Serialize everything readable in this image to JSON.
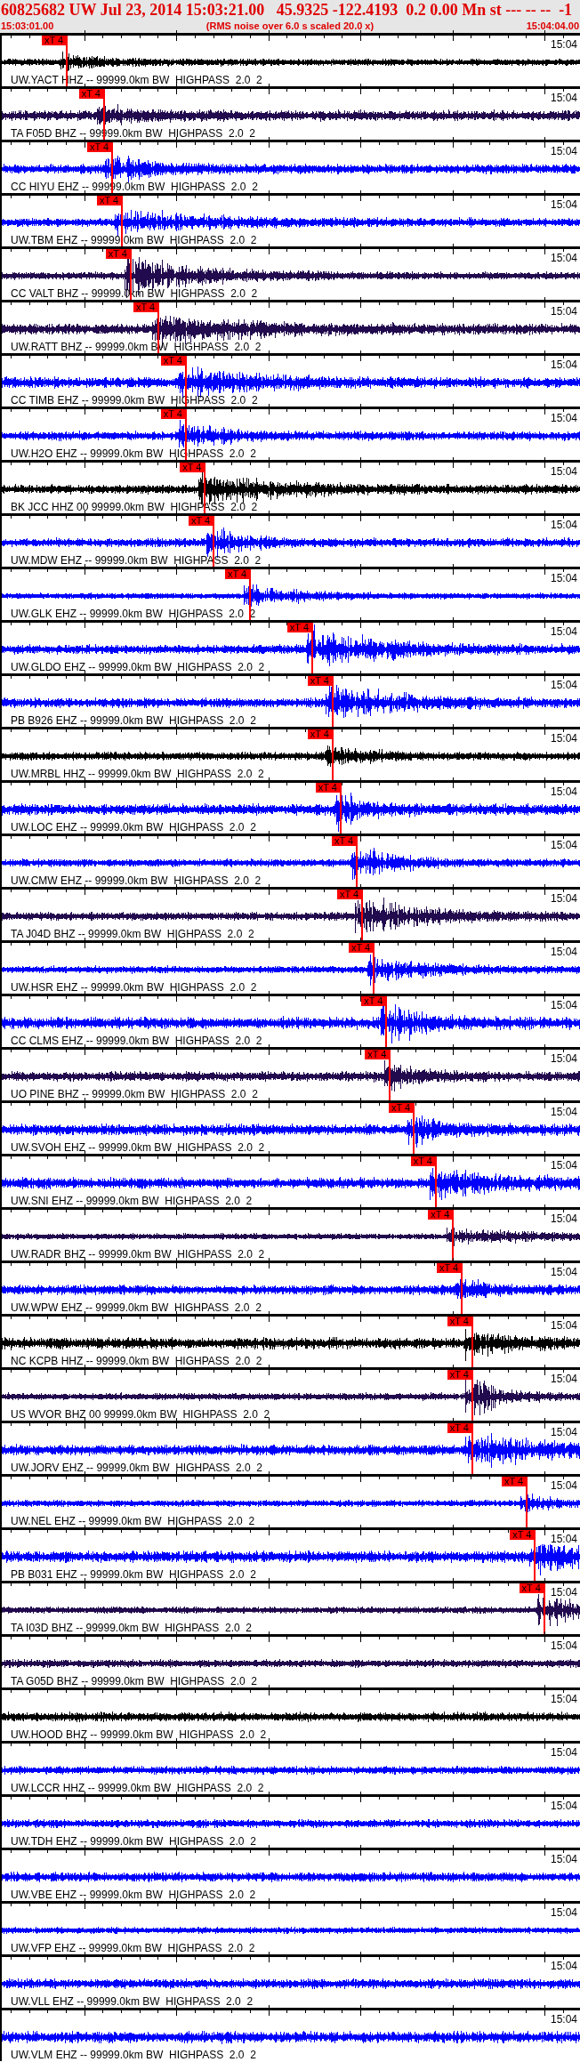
{
  "header": {
    "title": "60825682 UW Jul 23, 2014 15:03:21.00   45.9325 -122.4193  0.2 0.00 Mn st --- -- --  -1",
    "start_time": "15:03:01.00",
    "subtitle": "(RMS noise over 6.0 s scaled 20.0 x)",
    "end_time": "15:04:04.00"
  },
  "traces": [
    {
      "label": "UW.YACT HHZ -- 99999.0km BW  HIGHPASS  2.0  2",
      "color": "#000000",
      "time_label": "15:04",
      "pick": {
        "label": "xT 4",
        "level": 0.112
      }
    },
    {
      "label": "TA F05D BHZ -- 99999.0km BW  HIGHPASS  2.0  2",
      "color": "#220a4e",
      "time_label": "15:04",
      "pick": {
        "label": "xT 4",
        "level": 0.176
      }
    },
    {
      "label": "CC HIYU EHZ -- 99999.0km BW  HIGHPASS  2.0  2",
      "color": "#0000ff",
      "time_label": "15:04",
      "pick": {
        "label": "xT 4",
        "level": 0.19
      }
    },
    {
      "label": "UW.TBM EHZ -- 99999.0km BW  HIGHPASS  2.0  2",
      "color": "#0000ff",
      "time_label": "15:04",
      "pick": {
        "label": "xT 4",
        "level": 0.207
      }
    },
    {
      "label": "CC VALT BHZ -- 99999.0km BW  HIGHPASS  2.0  2",
      "color": "#220a4e",
      "time_label": "15:04",
      "pick": {
        "label": "xT 4",
        "level": 0.222
      }
    },
    {
      "label": "UW.RATT BHZ -- 99999.0km BW  HIGHPASS  2.0  2",
      "color": "#220a4e",
      "time_label": "15:04",
      "pick": {
        "label": "xT 4",
        "level": 0.27
      }
    },
    {
      "label": "CC TIMB EHZ -- 99999.0km BW  HIGHPASS  2.0  2",
      "color": "#0000ff",
      "time_label": "15:04",
      "pick": {
        "label": "xT 4",
        "level": 0.317
      }
    },
    {
      "label": "UW.H2O EHZ -- 99999.0km BW  HIGHPASS  2.0  2",
      "color": "#0000ff",
      "time_label": "15:04",
      "pick": {
        "label": "xT 4",
        "level": 0.317
      }
    },
    {
      "label": "BK JCC HHZ 00 99999.0km BW  HIGHPASS  2.0  2",
      "color": "#000000",
      "time_label": "15:04",
      "pick": {
        "label": "xT 4",
        "level": 0.35
      }
    },
    {
      "label": "UW.MDW EHZ -- 99999.0km BW  HIGHPASS  2.0  2",
      "color": "#0000ff",
      "time_label": "15:04",
      "pick": {
        "label": "xT 4",
        "level": 0.365
      }
    },
    {
      "label": "UW.GLK EHZ -- 99999.0km BW  HIGHPASS  2.0  2",
      "color": "#0000ff",
      "time_label": "15:04",
      "pick": {
        "label": "xT 4",
        "level": 0.428
      }
    },
    {
      "label": "UW.GLDO EHZ -- 99999.0km BW  HIGHPASS  2.0  2",
      "color": "#0000ff",
      "time_label": "15:04",
      "pick": {
        "label": "xT 4",
        "level": 0.535
      }
    },
    {
      "label": "PB B926 EHZ -- 99999.0km BW  HIGHPASS  2.0  2",
      "color": "#0000ff",
      "time_label": "15:04",
      "pick": {
        "label": "xT 4",
        "level": 0.57
      }
    },
    {
      "label": "UW.MRBL HHZ -- 99999.0km BW  HIGHPASS  2.0  2",
      "color": "#000000",
      "time_label": "15:04",
      "pick": {
        "label": "xT 4",
        "level": 0.57
      }
    },
    {
      "label": "UW.LOC EHZ -- 99999.0km BW  HIGHPASS  2.0  2",
      "color": "#0000ff",
      "time_label": "15:04",
      "pick": {
        "label": "xT 4",
        "level": 0.584
      }
    },
    {
      "label": "UW.CMW EHZ -- 99999.0km BW  HIGHPASS  2.0  2",
      "color": "#0000ff",
      "time_label": "15:04",
      "pick": {
        "label": "xT 4",
        "level": 0.612
      }
    },
    {
      "label": "TA J04D BHZ -- 99999.0km BW  HIGHPASS  2.0  2",
      "color": "#220a4e",
      "time_label": "15:04",
      "pick": {
        "label": "xT 4",
        "level": 0.621
      }
    },
    {
      "label": "UW.HSR EHZ -- 99999.0km BW  HIGHPASS  2.0  2",
      "color": "#0000ff",
      "time_label": "15:04",
      "pick": {
        "label": "xT 4",
        "level": 0.641
      }
    },
    {
      "label": "CC CLMS EHZ -- 99999.0km BW  HIGHPASS  2.0  2",
      "color": "#0000ff",
      "time_label": "15:04",
      "pick": {
        "label": "xT 4",
        "level": 0.663
      }
    },
    {
      "label": "UO PINE BHZ -- 99999.0km BW  HIGHPASS  2.0  2",
      "color": "#220a4e",
      "time_label": "15:04",
      "pick": {
        "label": "xT 4",
        "level": 0.669
      }
    },
    {
      "label": "UW.SVOH EHZ -- 99999.0km BW  HIGHPASS  2.0  2",
      "color": "#0000ff",
      "time_label": "15:04",
      "pick": {
        "label": "xT 4",
        "level": 0.71
      }
    },
    {
      "label": "UW.SNI EHZ -- 99999.0km BW  HIGHPASS  2.0  2",
      "color": "#0000ff",
      "time_label": "15:04",
      "pick": {
        "label": "xT 4",
        "level": 0.748
      }
    },
    {
      "label": "UW.RADR BHZ -- 99999.0km BW  HIGHPASS  2.0  2",
      "color": "#220a4e",
      "time_label": "15:04",
      "pick": {
        "label": "xT 4",
        "level": 0.778
      }
    },
    {
      "label": "UW.WPW EHZ -- 99999.0km BW  HIGHPASS  2.0  2",
      "color": "#0000ff",
      "time_label": "15:04",
      "pick": {
        "label": "xT 4",
        "level": 0.793
      }
    },
    {
      "label": "NC KCPB HHZ -- 99999.0km BW  HIGHPASS  2.0  2",
      "color": "#000000",
      "time_label": "15:04",
      "pick": {
        "label": "xT 4",
        "level": 0.811
      }
    },
    {
      "label": "US WVOR BHZ 00 99999.0km BW  HIGHPASS  2.0  2",
      "color": "#220a4e",
      "time_label": "15:04",
      "pick": {
        "label": "xT 4",
        "level": 0.811
      }
    },
    {
      "label": "UW.JORV EHZ -- 99999.0km BW  HIGHPASS  2.0  2",
      "color": "#0000ff",
      "time_label": "15:04",
      "pick": {
        "label": "xT 4",
        "level": 0.811
      }
    },
    {
      "label": "UW.NEL EHZ -- 99999.0km BW  HIGHPASS  2.0  2",
      "color": "#0000ff",
      "time_label": "15:04",
      "pick": {
        "label": "xT 4",
        "level": 0.905
      }
    },
    {
      "label": "PB B031 EHZ -- 99999.0km BW  HIGHPASS  2.0  2",
      "color": "#0000ff",
      "time_label": "15:04",
      "pick": {
        "label": "xT 4",
        "level": 0.919
      }
    },
    {
      "label": "TA I03D BHZ -- 99999.0km BW  HIGHPASS  2.0  2",
      "color": "#220a4e",
      "time_label": "15:04",
      "pick": {
        "label": "xT 4",
        "level": 0.935
      }
    },
    {
      "label": "TA G05D BHZ -- 99999.0km BW  HIGHPASS  2.0  2",
      "color": "#220a4e",
      "time_label": "15:04"
    },
    {
      "label": "UW.HOOD BHZ -- 99999.0km BW  HIGHPASS  2.0  2",
      "color": "#000000",
      "time_label": "15:04"
    },
    {
      "label": "UW.LCCR HHZ -- 99999.0km BW  HIGHPASS  2.0  2",
      "color": "#0000ff",
      "time_label": "15:04"
    },
    {
      "label": "UW.TDH EHZ -- 99999.0km BW  HIGHPASS  2.0  2",
      "color": "#0000ff",
      "time_label": "15:04"
    },
    {
      "label": "UW.VBE EHZ -- 99999.0km BW  HIGHPASS  2.0  2",
      "color": "#0000ff",
      "time_label": "15:04"
    },
    {
      "label": "UW.VFP EHZ -- 99999.0km BW  HIGHPASS  2.0  2",
      "color": "#0000ff",
      "time_label": "15:04"
    },
    {
      "label": "UW.VLL EHZ -- 99999.0km BW  HIGHPASS  2.0  2",
      "color": "#0000ff",
      "time_label": "15:04"
    },
    {
      "label": "UW.VLM EHZ -- 99999.0km BW  HIGHPASS  2.0  2",
      "color": "#0000ff",
      "time_label": "15:04"
    }
  ]
}
